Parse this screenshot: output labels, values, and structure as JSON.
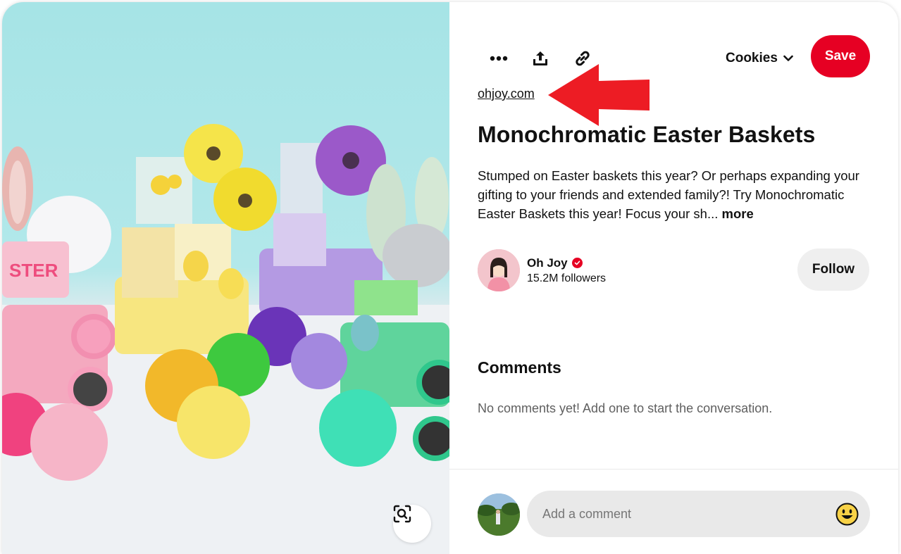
{
  "toolbar": {
    "more_icon": "ellipsis-icon",
    "share_icon": "share-upload-icon",
    "link_icon": "link-icon",
    "board_name": "Cookies",
    "board_chevron": "chevron-down-icon",
    "save_label": "Save"
  },
  "pin": {
    "source": "ohjoy.com",
    "title": "Monochromatic Easter Baskets",
    "description": "Stumped on Easter baskets this year? Or perhaps expanding your gifting to your friends and extended family?! Try Monochromatic Easter Baskets this year! Focus your sh",
    "ellipsis": "...",
    "more_label": " more"
  },
  "creator": {
    "name": "Oh Joy",
    "followers": "15.2M followers",
    "follow_label": "Follow"
  },
  "comments": {
    "title": "Comments",
    "empty_text": "No comments yet! Add one to start the conversation.",
    "input_placeholder": "Add a comment"
  },
  "colors": {
    "brand_red": "#e60023",
    "annotation_red": "#ed1c24",
    "follow_bg": "#efefef",
    "input_bg": "#e9e9e9"
  }
}
